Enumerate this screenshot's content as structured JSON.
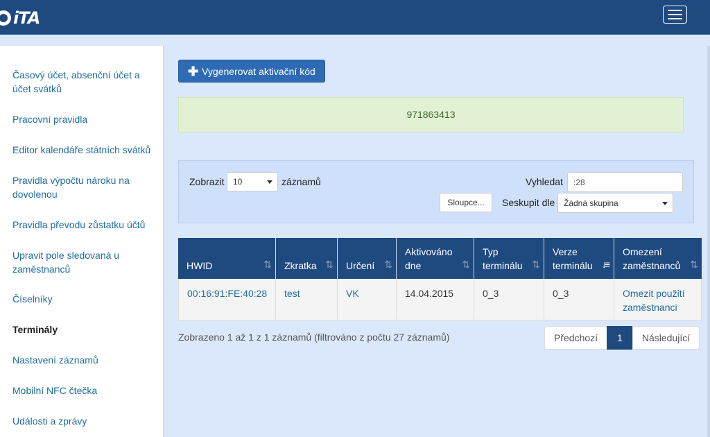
{
  "header": {
    "logo_text": "iTA",
    "menu_icon": "hamburger-icon"
  },
  "sidebar": {
    "items": [
      {
        "label": "Časový účet, absenční účet a účet svátků"
      },
      {
        "label": "Pracovní pravidla"
      },
      {
        "label": "Editor kalendáře státních svátků"
      },
      {
        "label": "Pravidla výpočtu nároku na dovolenou"
      },
      {
        "label": "Pravidla převodu zůstatku účtů"
      },
      {
        "label": "Upravit pole sledovaná u zaměstnanců"
      },
      {
        "label": "Číselníky"
      },
      {
        "label": "Terminály",
        "active": true
      },
      {
        "label": "Nastavení záznamů"
      },
      {
        "label": "Mobilní NFC čtečka"
      },
      {
        "label": "Události a zprávy"
      }
    ]
  },
  "main": {
    "generate_button": "Vygenerovat aktivační kód",
    "generate_icon": "plus-icon",
    "activation_code": "971863413",
    "filter": {
      "show_label": "Zobrazit",
      "page_size": "10",
      "records_label": "záznamů",
      "search_label": "Vyhledat",
      "search_value": ":28",
      "columns_button": "Sloupce...",
      "group_label": "Seskupit dle",
      "group_value": "Žádná skupina"
    },
    "table": {
      "headers": [
        "HWID",
        "Zkratka",
        "Určení",
        "Aktivováno dne",
        "Typ terminálu",
        "Verze terminálu",
        "Omezení zaměstnanců"
      ],
      "rows": [
        [
          "00:16:91:FE:40:28",
          "test",
          "VK",
          "14.04.2015",
          "0_3",
          "0_3",
          "Omezit použití zaměstnanci"
        ]
      ]
    },
    "info": "Zobrazeno 1 až 1 z 1 záznamů (filtrováno z počtu 27 záznamů)",
    "pagination": {
      "previous": "Předchozí",
      "current": "1",
      "next": "Následující"
    }
  },
  "colors": {
    "header_bg": "#1f4a80",
    "accent_button": "#2f6bb5",
    "link": "#1f6c9e",
    "page_bg": "#dbe8fb",
    "alert_bg": "#e2f0d4"
  }
}
